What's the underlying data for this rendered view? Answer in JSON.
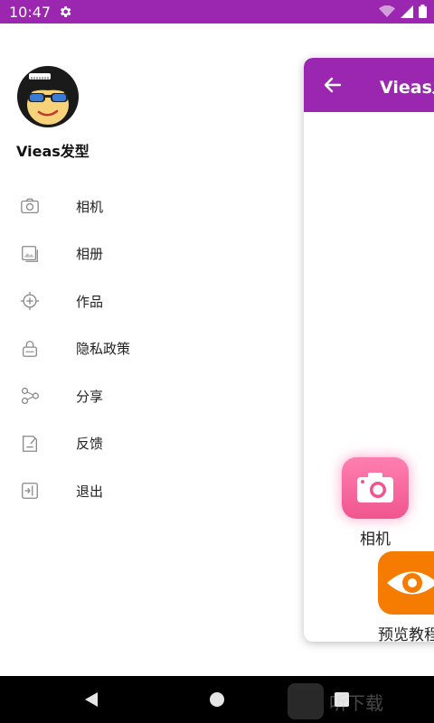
{
  "status_bar": {
    "time": "10:47",
    "icons": [
      "gear-icon",
      "wifi-icon",
      "signal-icon",
      "battery-icon"
    ],
    "color": "#9b27b0"
  },
  "drawer": {
    "app_name": "Vieas发型",
    "items": [
      {
        "label": "相机",
        "icon": "camera-icon"
      },
      {
        "label": "相册",
        "icon": "album-icon"
      },
      {
        "label": "作品",
        "icon": "works-icon"
      },
      {
        "label": "隐私政策",
        "icon": "lock-icon"
      },
      {
        "label": "分享",
        "icon": "share-icon"
      },
      {
        "label": "反馈",
        "icon": "feedback-icon"
      },
      {
        "label": "退出",
        "icon": "exit-icon"
      }
    ]
  },
  "main": {
    "title": "Vieas发型",
    "tiles": [
      {
        "label": "相机",
        "icon": "camera-icon",
        "color": "#f0558f"
      },
      {
        "label": "预览教程",
        "icon": "eye-icon",
        "color": "#f57c00"
      }
    ]
  },
  "nav_bar": {
    "buttons": [
      "back-icon",
      "home-icon",
      "recents-icon"
    ]
  },
  "watermark": {
    "text": "听下载"
  }
}
